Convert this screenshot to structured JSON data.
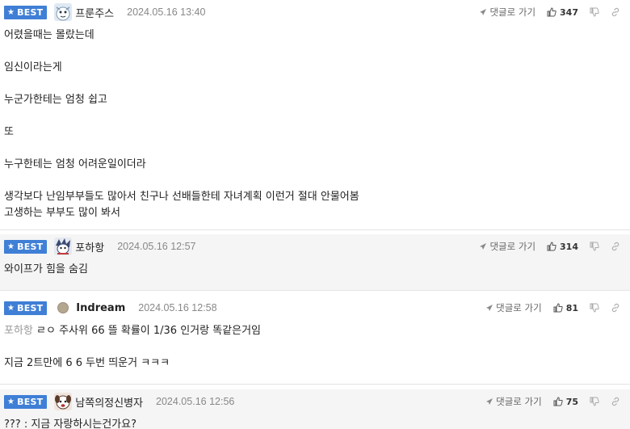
{
  "labels": {
    "best": "BEST",
    "reply": "댓글로 가기"
  },
  "colors": {
    "best_badge": "#3f7fd6",
    "alt_row": "#f5f5f5"
  },
  "comments": [
    {
      "nick": "프룬주스",
      "date": "2024.05.16 13:40",
      "likes": "347",
      "avatar_icon": "snow-creature-avatar",
      "lines": [
        "어렸을때는 몰랐는데",
        "",
        "임신이라는게",
        "",
        "누군가한테는 엄청 쉽고",
        "",
        "또",
        "",
        "누구한테는 엄청 어려운일이더라",
        "",
        "생각보다 난임부부들도 많아서 친구나 선배들한테 자녀계획 이런거 절대 안물어봄",
        "고생하는 부부도 많이 봐서"
      ]
    },
    {
      "nick": "포하항",
      "date": "2024.05.16 12:57",
      "likes": "314",
      "avatar_icon": "character-avatar",
      "lines": [
        "와이프가 힘을 숨김"
      ]
    },
    {
      "nick": "Indream",
      "date": "2024.05.16 12:58",
      "likes": "81",
      "avatar_icon": "circle-avatar",
      "reply_to": "포하항",
      "first_line": "ㄹㅇ 주사위 66 뜰 확률이 1/36 인거랑 똑같은거임",
      "lines": [
        "",
        "지금 2트만에 6 6 두번 띄운거 ㅋㅋㅋ"
      ]
    },
    {
      "nick": "남쪽의정신병자",
      "date": "2024.05.16 12:56",
      "likes": "75",
      "avatar_icon": "dog-face-avatar",
      "lines": [
        "??? : 지금 자랑하시는건가요?"
      ]
    }
  ]
}
